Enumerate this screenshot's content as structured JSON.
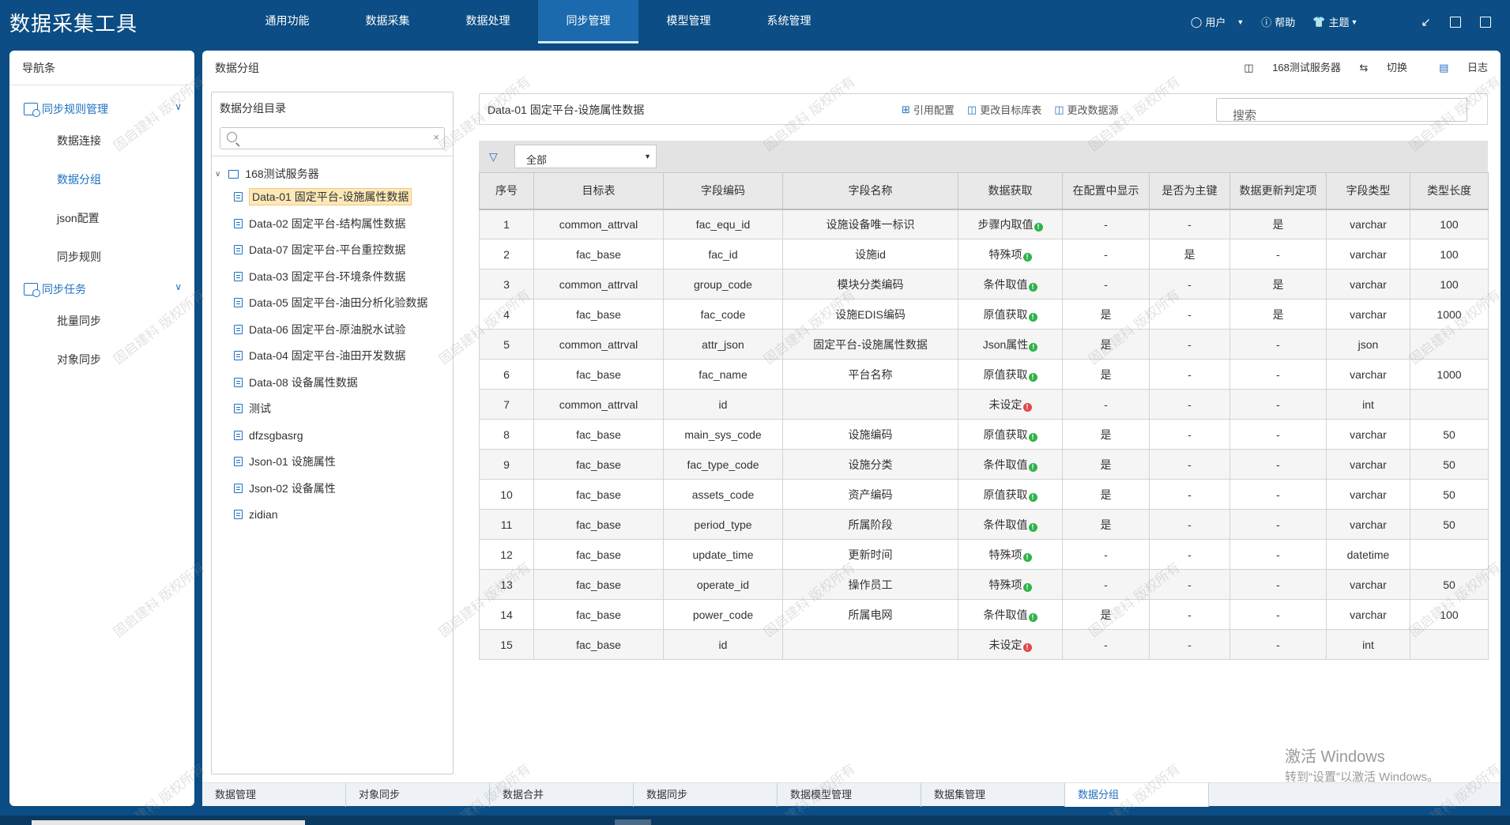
{
  "app": {
    "title": "数据采集工具"
  },
  "topnav": {
    "items": [
      "通用功能",
      "数据采集",
      "数据处理",
      "同步管理",
      "模型管理",
      "系统管理"
    ],
    "active_index": 3
  },
  "topright": {
    "user_label": "用户",
    "help_label": "帮助",
    "theme_label": "主题"
  },
  "sidebar": {
    "title": "导航条",
    "groups": [
      {
        "label": "同步规则管理",
        "items": [
          "数据连接",
          "数据分组",
          "json配置",
          "同步规则"
        ]
      },
      {
        "label": "同步任务",
        "items": [
          "批量同步",
          "对象同步"
        ]
      }
    ],
    "active_item": "数据分组"
  },
  "main": {
    "title": "数据分组",
    "server_label": "168测试服务器",
    "switch_label": "切换",
    "log_label": "日志"
  },
  "tree": {
    "title": "数据分组目录",
    "search_value": "",
    "root_label": "168测试服务器",
    "nodes": [
      "Data-01 固定平台-设施属性数据",
      "Data-02 固定平台-结构属性数据",
      "Data-07 固定平台-平台重控数据",
      "Data-03 固定平台-环境条件数据",
      "Data-05 固定平台-油田分析化验数据",
      "Data-06 固定平台-原油脱水试验",
      "Data-04 固定平台-油田开发数据",
      "Data-08 设备属性数据",
      "测试",
      "dfzsgbasrg",
      "Json-01 设施属性",
      "Json-02 设备属性",
      "zidian"
    ],
    "selected_index": 0
  },
  "detail": {
    "title": "Data-01 固定平台-设施属性数据",
    "actions": [
      "引用配置",
      "更改目标库表",
      "更改数据源"
    ],
    "search_placeholder": "搜索",
    "filter_value": "全部"
  },
  "table": {
    "columns": [
      "序号",
      "目标表",
      "字段编码",
      "字段名称",
      "数据获取",
      "在配置中显示",
      "是否为主键",
      "数据更新判定项",
      "字段类型",
      "类型长度"
    ],
    "rows": [
      {
        "no": "1",
        "target": "common_attrval",
        "code": "fac_equ_id",
        "name": "设施设备唯一标识",
        "fetch": "步骤内取值",
        "status": "ok",
        "show": "-",
        "pk": "-",
        "upd": "是",
        "type": "varchar",
        "len": "100"
      },
      {
        "no": "2",
        "target": "fac_base",
        "code": "fac_id",
        "name": "设施id",
        "fetch": "特殊项",
        "status": "ok",
        "show": "-",
        "pk": "是",
        "upd": "-",
        "type": "varchar",
        "len": "100"
      },
      {
        "no": "3",
        "target": "common_attrval",
        "code": "group_code",
        "name": "模块分类编码",
        "fetch": "条件取值",
        "status": "ok",
        "show": "-",
        "pk": "-",
        "upd": "是",
        "type": "varchar",
        "len": "100"
      },
      {
        "no": "4",
        "target": "fac_base",
        "code": "fac_code",
        "name": "设施EDIS编码",
        "fetch": "原值获取",
        "status": "ok",
        "show": "是",
        "pk": "-",
        "upd": "是",
        "type": "varchar",
        "len": "1000"
      },
      {
        "no": "5",
        "target": "common_attrval",
        "code": "attr_json",
        "name": "固定平台-设施属性数据",
        "fetch": "Json属性",
        "status": "ok",
        "show": "是",
        "pk": "-",
        "upd": "-",
        "type": "json",
        "len": ""
      },
      {
        "no": "6",
        "target": "fac_base",
        "code": "fac_name",
        "name": "平台名称",
        "fetch": "原值获取",
        "status": "ok",
        "show": "是",
        "pk": "-",
        "upd": "-",
        "type": "varchar",
        "len": "1000"
      },
      {
        "no": "7",
        "target": "common_attrval",
        "code": "id",
        "name": "",
        "fetch": "未设定",
        "status": "err",
        "show": "-",
        "pk": "-",
        "upd": "-",
        "type": "int",
        "len": ""
      },
      {
        "no": "8",
        "target": "fac_base",
        "code": "main_sys_code",
        "name": "设施编码",
        "fetch": "原值获取",
        "status": "ok",
        "show": "是",
        "pk": "-",
        "upd": "-",
        "type": "varchar",
        "len": "50"
      },
      {
        "no": "9",
        "target": "fac_base",
        "code": "fac_type_code",
        "name": "设施分类",
        "fetch": "条件取值",
        "status": "ok",
        "show": "是",
        "pk": "-",
        "upd": "-",
        "type": "varchar",
        "len": "50"
      },
      {
        "no": "10",
        "target": "fac_base",
        "code": "assets_code",
        "name": "资产编码",
        "fetch": "原值获取",
        "status": "ok",
        "show": "是",
        "pk": "-",
        "upd": "-",
        "type": "varchar",
        "len": "50"
      },
      {
        "no": "11",
        "target": "fac_base",
        "code": "period_type",
        "name": "所属阶段",
        "fetch": "条件取值",
        "status": "ok",
        "show": "是",
        "pk": "-",
        "upd": "-",
        "type": "varchar",
        "len": "50"
      },
      {
        "no": "12",
        "target": "fac_base",
        "code": "update_time",
        "name": "更新时间",
        "fetch": "特殊项",
        "status": "ok",
        "show": "-",
        "pk": "-",
        "upd": "-",
        "type": "datetime",
        "len": ""
      },
      {
        "no": "13",
        "target": "fac_base",
        "code": "operate_id",
        "name": "操作员工",
        "fetch": "特殊项",
        "status": "ok",
        "show": "-",
        "pk": "-",
        "upd": "-",
        "type": "varchar",
        "len": "50"
      },
      {
        "no": "14",
        "target": "fac_base",
        "code": "power_code",
        "name": "所属电网",
        "fetch": "条件取值",
        "status": "ok",
        "show": "是",
        "pk": "-",
        "upd": "-",
        "type": "varchar",
        "len": "100"
      },
      {
        "no": "15",
        "target": "fac_base",
        "code": "id",
        "name": "",
        "fetch": "未设定",
        "status": "err",
        "show": "-",
        "pk": "-",
        "upd": "-",
        "type": "int",
        "len": ""
      }
    ]
  },
  "bottom_tabs": {
    "items": [
      "数据管理",
      "对象同步",
      "数据合并",
      "数据同步",
      "数据模型管理",
      "数据集管理",
      "数据分组"
    ],
    "active_index": 6
  },
  "watermark_text": "固启建科 版权所有",
  "windows_activation": {
    "line1": "激活 Windows",
    "line2": "转到“设置”以激活 Windows。"
  },
  "colors": {
    "topbar": "#0b4d84",
    "accent": "#1f71c1",
    "ok_dot": "#2fb34a",
    "err_dot": "#e04848",
    "selected_node": "#fde9b8"
  }
}
